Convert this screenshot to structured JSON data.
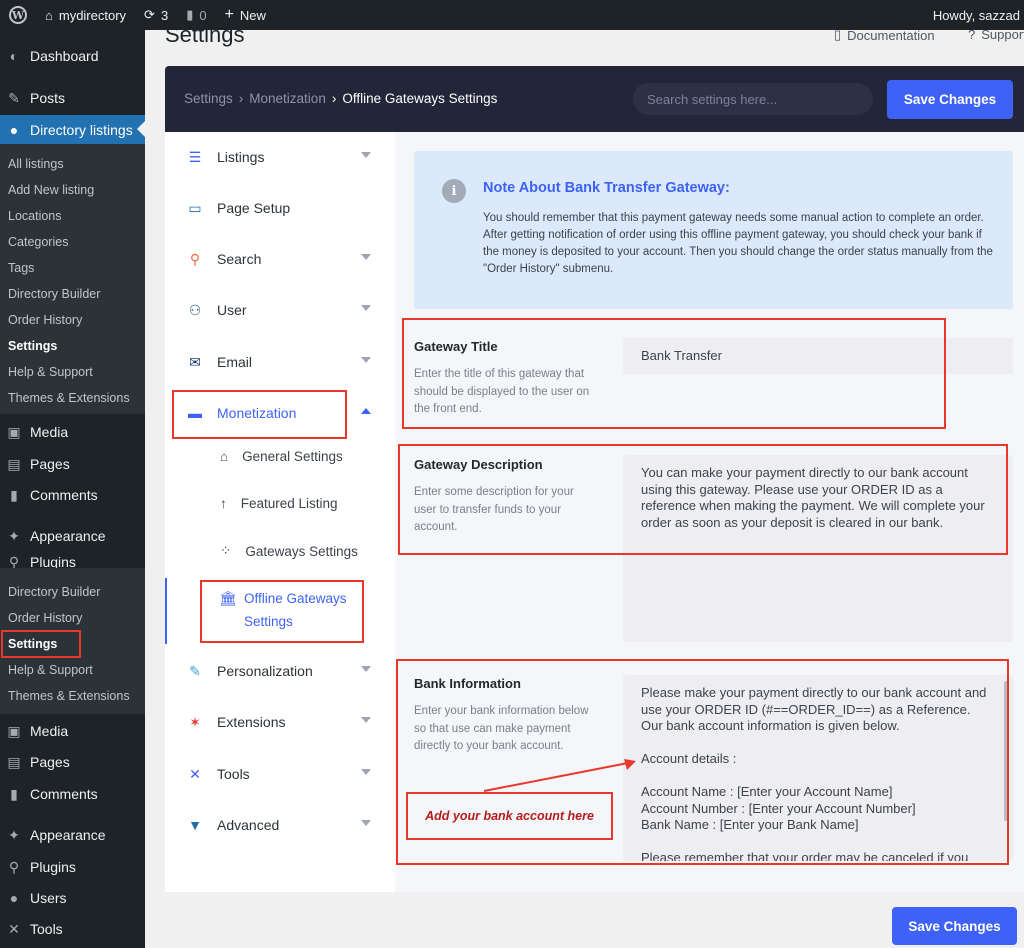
{
  "adminbar": {
    "site_name": "mydirectory",
    "updates_count": "3",
    "comments_count": "0",
    "new_label": "New",
    "howdy": "Howdy, sazzad"
  },
  "sidebar": {
    "dashboard": "Dashboard",
    "posts": "Posts",
    "directory_listings": "Directory listings",
    "submenu": [
      "All listings",
      "Add New listing",
      "Locations",
      "Categories",
      "Tags",
      "Directory Builder",
      "Order History",
      "Settings",
      "Help & Support",
      "Themes & Extensions"
    ],
    "media": "Media",
    "pages": "Pages",
    "comments": "Comments",
    "appearance": "Appearance",
    "plugins": "Plugins",
    "submenu2": [
      "Directory Builder",
      "Order History",
      "Settings",
      "Help & Support",
      "Themes & Extensions"
    ],
    "media2": "Media",
    "pages2": "Pages",
    "comments2": "Comments",
    "appearance2": "Appearance",
    "plugins2": "Plugins",
    "users": "Users",
    "tools": "Tools"
  },
  "page": {
    "title": "Settings",
    "documentation": "Documentation",
    "support": "Support"
  },
  "header": {
    "crumb1": "Settings",
    "crumb2": "Monetization",
    "crumb3": "Offline Gateways Settings",
    "search_placeholder": "Search settings here...",
    "save_label": "Save Changes"
  },
  "nav": {
    "listings": "Listings",
    "page_setup": "Page Setup",
    "search": "Search",
    "user": "User",
    "email": "Email",
    "monetization": "Monetization",
    "general_settings": "General Settings",
    "featured_listing": "Featured Listing",
    "gateways_settings": "Gateways Settings",
    "offline_1": "Offline Gateways",
    "offline_2": "Settings",
    "personalization": "Personalization",
    "extensions": "Extensions",
    "tools": "Tools",
    "advanced": "Advanced"
  },
  "note": {
    "title": "Note About Bank Transfer Gateway:",
    "text": "You should remember that this payment gateway needs some manual action to complete an order. After getting notification of order using this offline payment gateway, you should check your bank if the money is deposited to your account. Then you should change the order status manually from the \"Order History\" submenu."
  },
  "fields": {
    "title_label": "Gateway Title",
    "title_desc": "Enter the title of this gateway that should be displayed to the user on the front end.",
    "title_value": "Bank Transfer",
    "desc_label": "Gateway Description",
    "desc_desc": "Enter some description for your user to transfer funds to your account.",
    "desc_value": "You can make your payment directly to our bank account using this gateway. Please use your ORDER ID as a reference when making the payment. We will complete your order as soon as your deposit is cleared in our bank.",
    "bank_label": "Bank Information",
    "bank_desc": "Enter your bank information below so that use can make payment directly to your bank account.",
    "bank_value": "Please make your payment directly to our bank account and use your ORDER ID (#==ORDER_ID==) as a Reference. Our bank account information is given below.\n\nAccount details :\n\nAccount Name : [Enter your Account Name]\nAccount Number : [Enter your Account Number]\nBank Name : [Enter your Bank Name]\n\nPlease remember that your order may be canceled if you"
  },
  "annotation": {
    "text": "Add your bank account here"
  },
  "footer": {
    "save_label": "Save Changes"
  },
  "colors": {
    "accent": "#3e62f5",
    "annotation_red": "#e8382c",
    "header_dark": "#232539",
    "wp_blue": "#2271b1"
  }
}
